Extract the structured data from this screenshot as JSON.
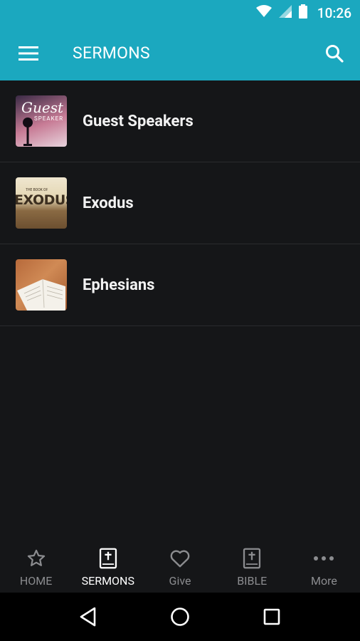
{
  "status": {
    "time": "10:26"
  },
  "app_bar": {
    "title": "SERMONS"
  },
  "sermon_series": [
    {
      "label": "Guest Speakers",
      "thumb_text_1": "Guest",
      "thumb_text_2": "SPEAKER"
    },
    {
      "label": "Exodus",
      "thumb_text_1": "THE BOOK OF",
      "thumb_text_2": "EXODUS"
    },
    {
      "label": "Ephesians"
    }
  ],
  "bottom_nav": [
    {
      "label": "HOME",
      "icon": "star-icon",
      "active": false
    },
    {
      "label": "SERMONS",
      "icon": "bible-icon",
      "active": true
    },
    {
      "label": "Give",
      "icon": "heart-icon",
      "active": false
    },
    {
      "label": "BIBLE",
      "icon": "bible-icon",
      "active": false
    },
    {
      "label": "More",
      "icon": "more-icon",
      "active": false
    }
  ],
  "colors": {
    "primary": "#1ba8bf",
    "background": "#151618",
    "active_tab": "#ffffff",
    "inactive_tab": "#8b8c8f"
  }
}
